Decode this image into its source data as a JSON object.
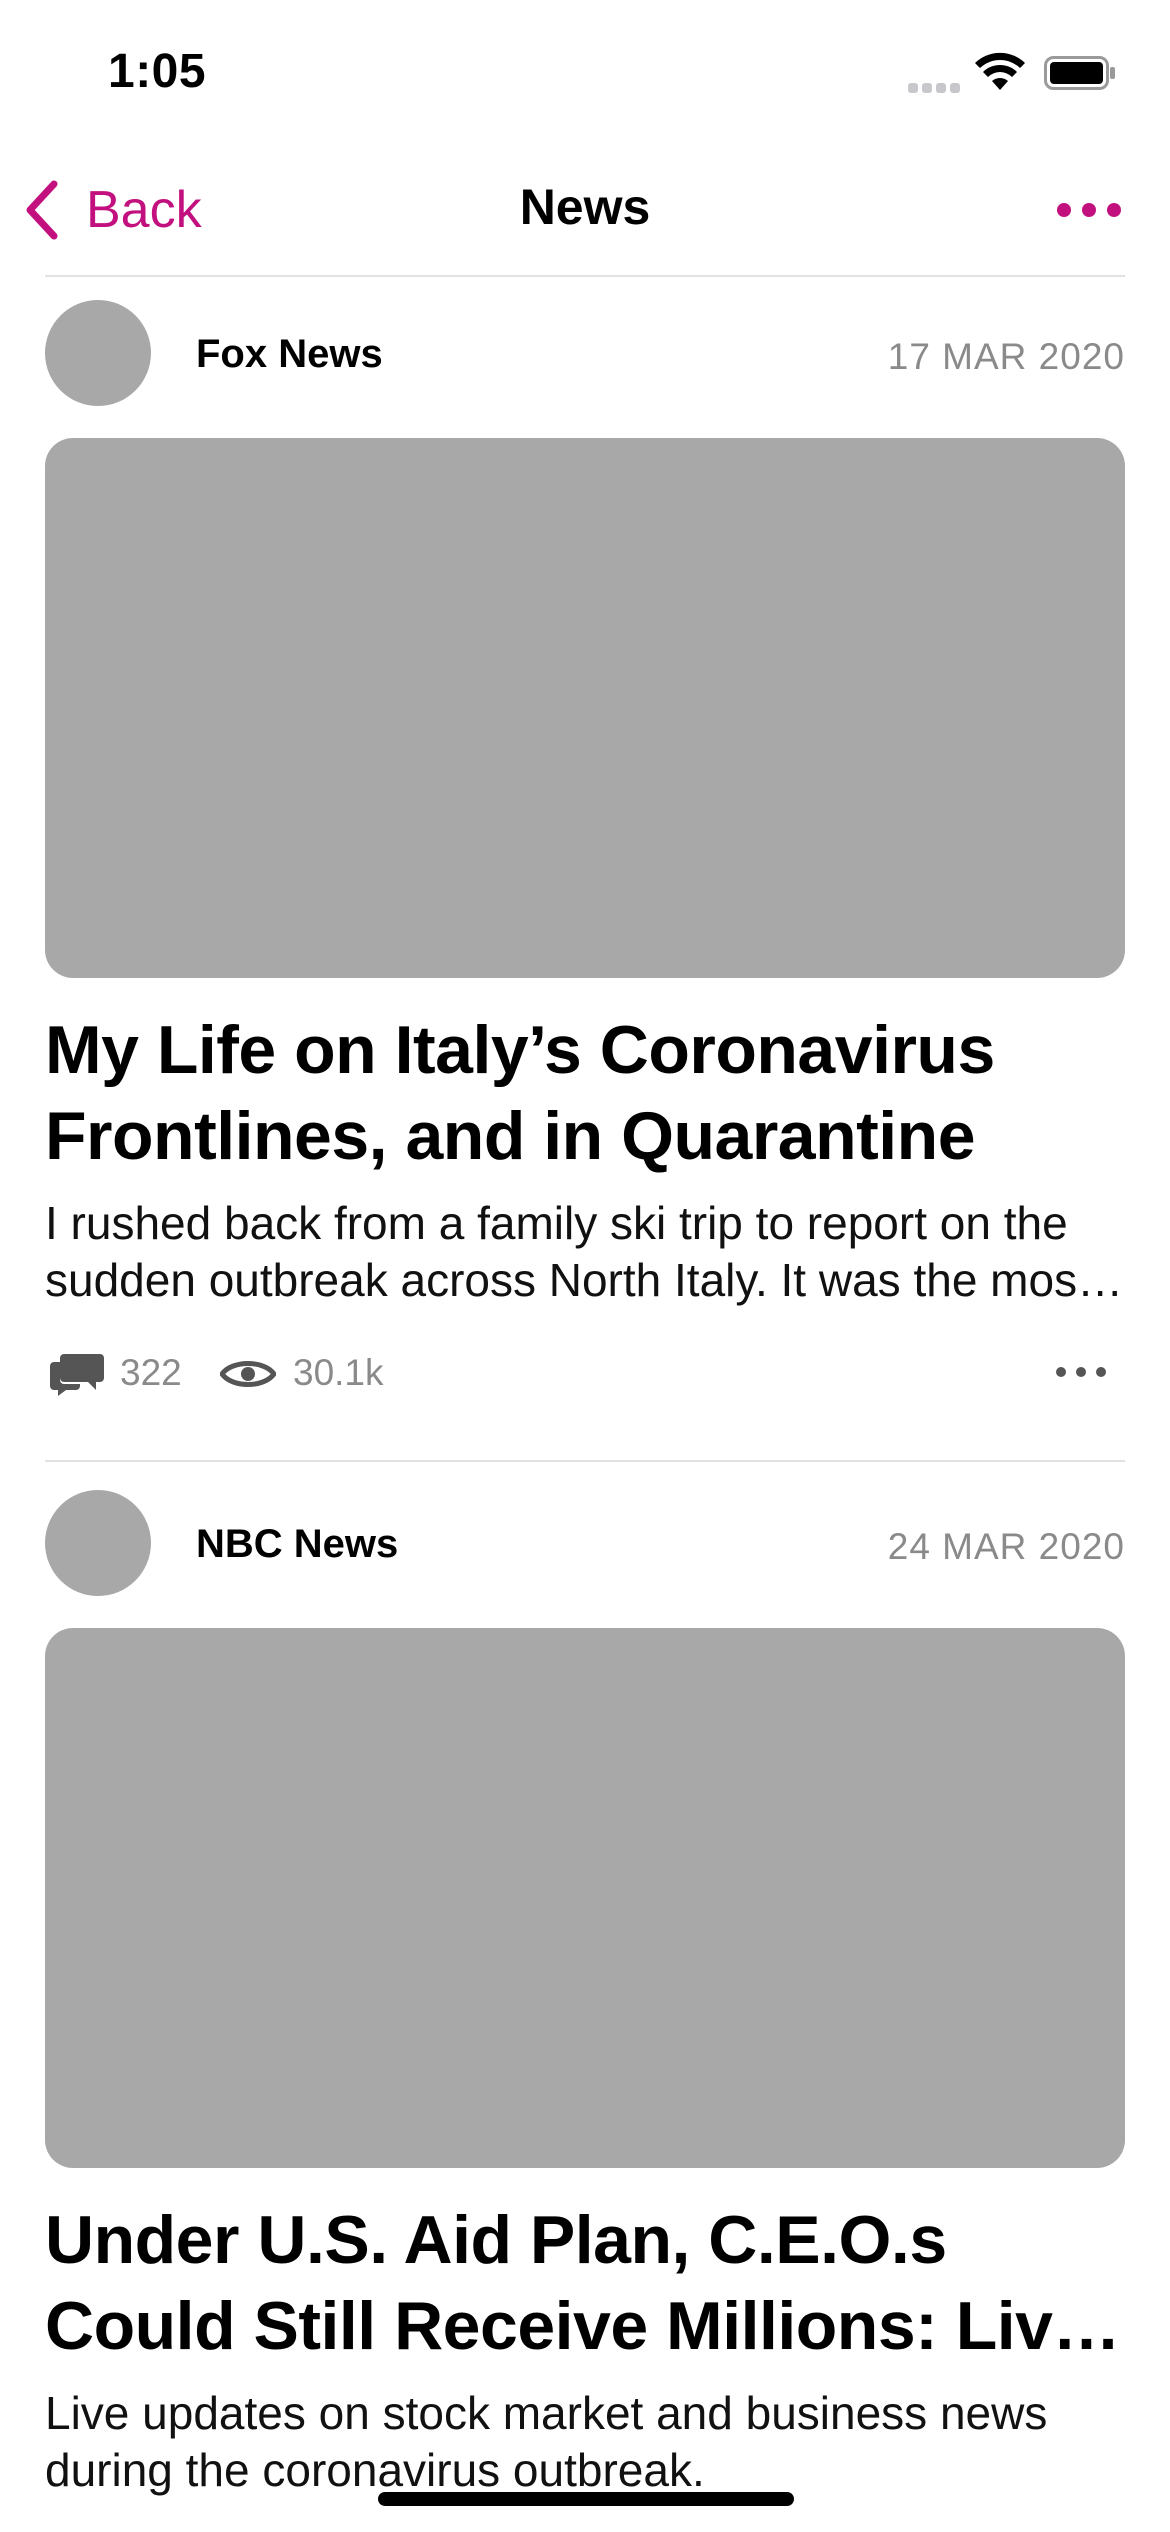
{
  "status_bar": {
    "time": "1:05"
  },
  "nav": {
    "back_label": "Back",
    "title": "News",
    "accent_color": "#c2117f"
  },
  "articles": [
    {
      "source": "Fox News",
      "date": "17 MAR 2020",
      "title": "My Life on Italy’s Coronavirus Frontlines, and in Quarantine",
      "summary": "I rushed back from a family ski trip to report on the sudden outbreak across North Italy. It was the most difficult reporting assignment",
      "comments": "322",
      "views": "30.1k"
    },
    {
      "source": "NBC News",
      "date": "24 MAR 2020",
      "title": "Under U.S. Aid Plan, C.E.O.s Could Still Receive Millions: Live Updates",
      "summary": "Live updates on stock market and business news during the coronavirus outbreak."
    }
  ],
  "icons": {
    "back": "chevron-left-icon",
    "more": "ellipsis-icon",
    "comments": "speech-bubbles-icon",
    "views": "eye-icon",
    "signal": "cellular-signal-icon",
    "wifi": "wifi-icon",
    "battery": "battery-icon"
  }
}
